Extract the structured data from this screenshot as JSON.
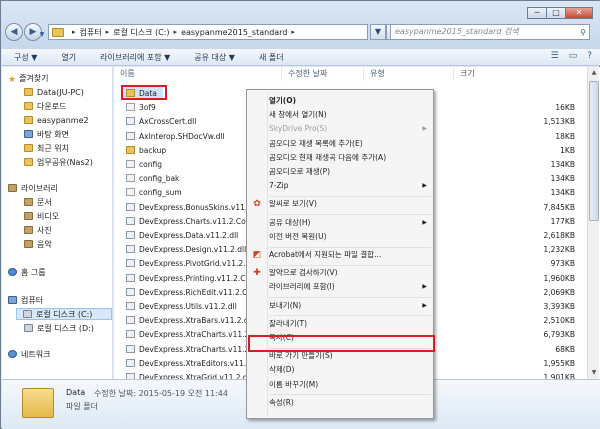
{
  "window": {
    "controls": {
      "minimize": "─",
      "maximize": "□",
      "close": "✕"
    }
  },
  "address_bar": {
    "crumbs": [
      "컴퓨터",
      "로컬 디스크 (C:)",
      "easypanme2015_standard"
    ],
    "search_placeholder": "easypanme2015_standard 검색"
  },
  "toolbar": {
    "items": [
      "구성 ▼",
      "열기",
      "라이브러리에 포함 ▼",
      "공유 대상 ▼",
      "새 폴더"
    ]
  },
  "nav": {
    "favorites_title": "즐겨찾기",
    "favorites": [
      "Data(JU-PC)",
      "다운로드",
      "easypanme2",
      "바탕 화면",
      "최근 위치",
      "업무공유(Nas2)"
    ],
    "libraries_title": "라이브러리",
    "libraries": [
      "문서",
      "비디오",
      "사진",
      "음악"
    ],
    "homegroup": "홈 그룹",
    "computer_title": "컴퓨터",
    "drives": [
      "로컬 디스크 (C:)",
      "로컬 디스크 (D:)"
    ],
    "network": "네트워크"
  },
  "columns": {
    "name": "이름",
    "modified": "수정한 날짜",
    "type": "유형",
    "size": "크기"
  },
  "files": [
    {
      "name": "Data",
      "kind": "folder",
      "size": ""
    },
    {
      "name": "3of9",
      "kind": "cfg",
      "size": "16KB"
    },
    {
      "name": "AxCrossCert.dll",
      "kind": "dll",
      "size": "1,513KB"
    },
    {
      "name": "AxInterop.SHDocVw.dll",
      "kind": "dll",
      "size": "18KB"
    },
    {
      "name": "backup",
      "kind": "folder",
      "size": "1KB"
    },
    {
      "name": "config",
      "kind": "cfg",
      "size": "134KB"
    },
    {
      "name": "config_bak",
      "kind": "cfg",
      "size": "134KB"
    },
    {
      "name": "config_sum",
      "kind": "cfg",
      "size": "134KB"
    },
    {
      "name": "DevExpress.BonusSkins.v11.2.dll",
      "kind": "dll",
      "size": "7,845KB"
    },
    {
      "name": "DevExpress.Charts.v11.2.Core.dll",
      "kind": "dll",
      "size": "177KB"
    },
    {
      "name": "DevExpress.Data.v11.2.dll",
      "kind": "dll",
      "size": "2,618KB"
    },
    {
      "name": "DevExpress.Design.v11.2.dll",
      "kind": "dll",
      "size": "1,232KB"
    },
    {
      "name": "DevExpress.PivotGrid.v11.2.Core",
      "kind": "dll",
      "size": "973KB"
    },
    {
      "name": "DevExpress.Printing.v11.2.Core",
      "kind": "dll",
      "size": "1,960KB"
    },
    {
      "name": "DevExpress.RichEdit.v11.2.Core",
      "kind": "dll",
      "size": "2,069KB"
    },
    {
      "name": "DevExpress.Utils.v11.2.dll",
      "kind": "dll",
      "size": "3,393KB"
    },
    {
      "name": "DevExpress.XtraBars.v11.2.dll",
      "kind": "dll",
      "size": "2,510KB"
    },
    {
      "name": "DevExpress.XtraCharts.v11.2.dll",
      "kind": "dll",
      "size": "6,793KB"
    },
    {
      "name": "DevExpress.XtraCharts.v11.2.U",
      "kind": "dll",
      "size": "68KB"
    },
    {
      "name": "DevExpress.XtraEditors.v11.2.dll",
      "kind": "dll",
      "size": "1,955KB"
    },
    {
      "name": "DevExpress.XtraGrid.v11.2.dll",
      "kind": "dll",
      "size": "1,901KB"
    }
  ],
  "context_menu": [
    {
      "label": "열기(O)",
      "bold": true
    },
    {
      "label": "새 창에서 열기(N)"
    },
    {
      "label": "SkyDrive Pro(S)",
      "disabled": true,
      "submenu": true
    },
    {
      "label": "곰오디오 재생 목록에 추가(E)"
    },
    {
      "label": "곰오디오 현재 재생곡 다음에 추가(A)"
    },
    {
      "label": "곰오디오로 재생(P)"
    },
    {
      "label": "7-Zip",
      "submenu": true
    },
    {
      "sep": true
    },
    {
      "label": "알씨로 보기(V)",
      "icon": "✿"
    },
    {
      "sep": true
    },
    {
      "label": "공유 대상(H)",
      "submenu": true
    },
    {
      "label": "이전 버전 복원(U)"
    },
    {
      "sep": true
    },
    {
      "label": "Acrobat에서 지원되는 파일 결합...",
      "icon": "◩"
    },
    {
      "sep": true
    },
    {
      "label": "알약으로 검사하기(V)",
      "icon": "✚"
    },
    {
      "label": "라이브러리에 포함(I)",
      "submenu": true
    },
    {
      "sep": true
    },
    {
      "label": "보내기(N)",
      "submenu": true
    },
    {
      "sep": true
    },
    {
      "label": "잘라내기(T)"
    },
    {
      "label": "복사(C)"
    },
    {
      "sep": true
    },
    {
      "label": "바로 가기 만들기(S)"
    },
    {
      "label": "삭제(D)"
    },
    {
      "label": "이름 바꾸기(M)"
    },
    {
      "sep": true
    },
    {
      "label": "속성(R)"
    }
  ],
  "details": {
    "name": "Data",
    "modified": "수정한 날짜: 2015-05-19 오전 11:44",
    "type": "파일 폴더"
  }
}
